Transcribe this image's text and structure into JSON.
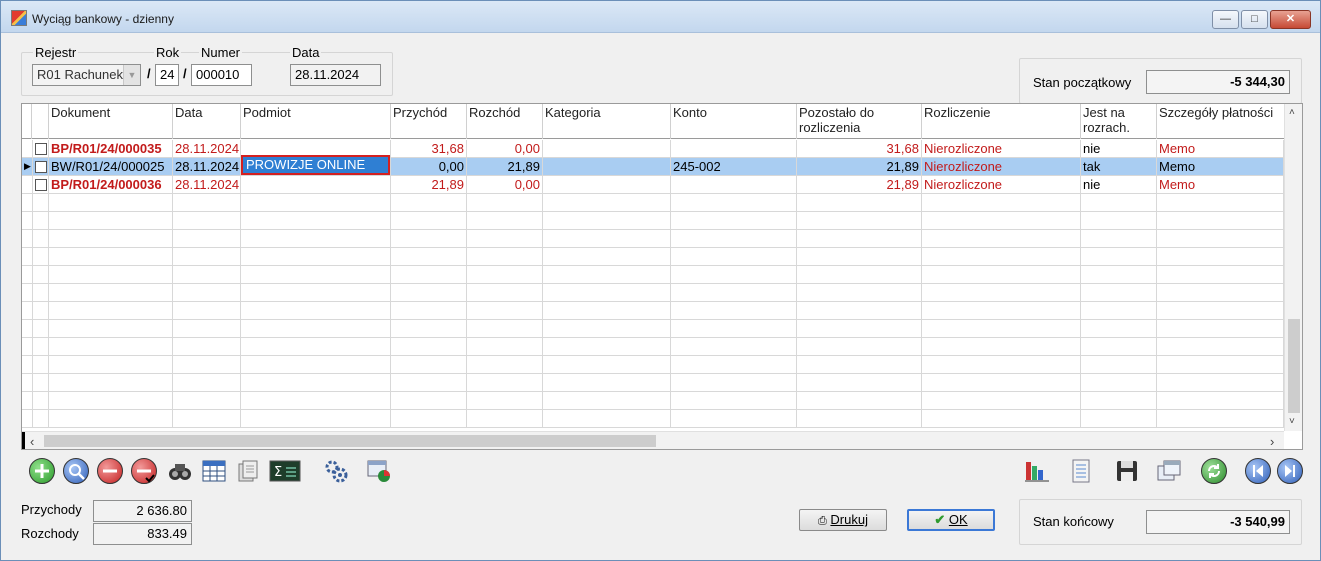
{
  "window": {
    "title": "Wyciąg bankowy - dzienny"
  },
  "header": {
    "rejestr_label": "Rejestr",
    "rok_label": "Rok",
    "numer_label": "Numer",
    "data_label": "Data",
    "rejestr_value": "R01 Rachunek",
    "slash": "/",
    "rok_value": "24",
    "numer_value": "000010",
    "data_value": "28.11.2024",
    "stan_poczatkowy_label": "Stan początkowy",
    "stan_poczatkowy_value": "-5 344,30"
  },
  "grid": {
    "columns": {
      "dokument": "Dokument",
      "data": "Data",
      "podmiot": "Podmiot",
      "przychod": "Przychód",
      "rozchod": "Rozchód",
      "kategoria": "Kategoria",
      "konto": "Konto",
      "pozostalo": "Pozostało do rozliczenia",
      "rozliczenie": "Rozliczenie",
      "jest_na": "Jest na rozrach.",
      "szczegoly": "Szczegóły płatności"
    },
    "rows": [
      {
        "dokument": "BP/R01/24/000035",
        "data": "28.11.2024",
        "podmiot": "",
        "przychod": "31,68",
        "rozchod": "0,00",
        "kategoria": "",
        "konto": "",
        "pozostalo": "31,68",
        "rozliczenie": "Nierozliczone",
        "jest_na": "nie",
        "szczegoly": "Memo"
      },
      {
        "dokument": "BW/R01/24/000025",
        "data": "28.11.2024",
        "podmiot": "PROWIZJE ONLINE",
        "przychod": "0,00",
        "rozchod": "21,89",
        "kategoria": "",
        "konto": "245-002",
        "pozostalo": "21,89",
        "rozliczenie": "Nierozliczone",
        "jest_na": "tak",
        "szczegoly": "Memo"
      },
      {
        "dokument": "BP/R01/24/000036",
        "data": "28.11.2024",
        "podmiot": "",
        "przychod": "21,89",
        "rozchod": "0,00",
        "kategoria": "",
        "konto": "",
        "pozostalo": "21,89",
        "rozliczenie": "Nierozliczone",
        "jest_na": "nie",
        "szczegoly": "Memo"
      }
    ],
    "selected_row": 1
  },
  "toolbar_icons": [
    "add-icon",
    "preview-icon",
    "delete-icon",
    "delete-confirm-icon",
    "search-binoculars-icon",
    "table-icon",
    "documents-icon",
    "sum-icon",
    "settings-gears-icon",
    "window-chart-icon",
    "chart-icon",
    "document-list-icon",
    "save-icon",
    "windows-icon",
    "refresh-icon",
    "previous-icon",
    "next-icon"
  ],
  "footer": {
    "przychody_label": "Przychody",
    "przychody_value": "2 636.80",
    "rozchody_label": "Rozchody",
    "rozchody_value": "833.49",
    "drukuj_label": "Drukuj",
    "ok_label": "OK",
    "stan_koncowy_label": "Stan końcowy",
    "stan_koncowy_value": "-3 540,99"
  },
  "colors": {
    "selection": "#a9cdf2",
    "accent_red": "#c21b1b",
    "edit_cell": "#2f7fd3"
  }
}
